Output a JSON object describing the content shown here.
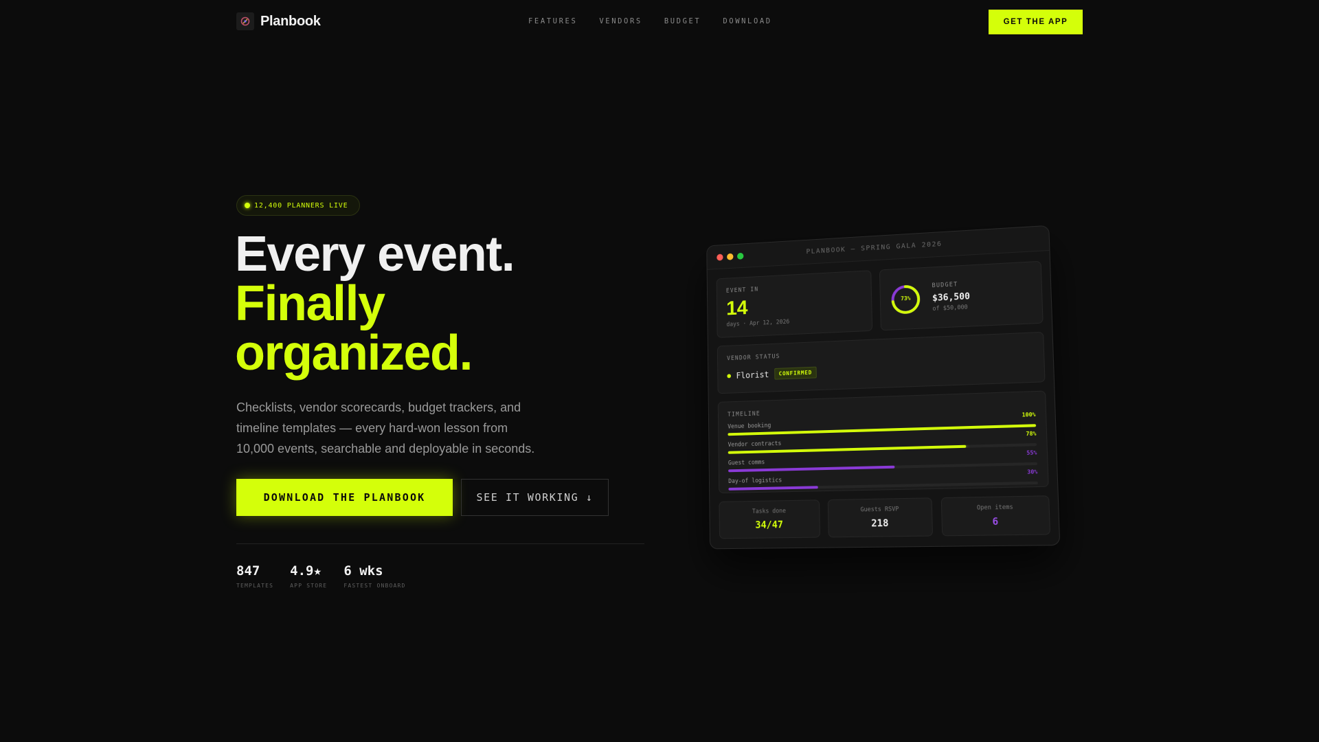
{
  "nav": {
    "brand": "Planbook",
    "links": [
      "FEATURES",
      "VENDORS",
      "BUDGET",
      "DOWNLOAD"
    ],
    "cta": "GET THE APP"
  },
  "hero": {
    "badge": "12,400 PLANNERS LIVE",
    "headline_1": "Every event.",
    "headline_2": "Finally",
    "headline_3": "organized.",
    "lede": "Checklists, vendor scorecards, budget trackers, and timeline templates — every hard-won lesson from 10,000 events, searchable and deployable in seconds.",
    "primary_cta": "DOWNLOAD THE PLANBOOK",
    "secondary_cta": "SEE IT WORKING ↓",
    "stats": [
      {
        "value": "847",
        "label": "TEMPLATES"
      },
      {
        "value": "4.9★",
        "label": "APP STORE"
      },
      {
        "value": "6 wks",
        "label": "FASTEST ONBOARD"
      }
    ]
  },
  "dashboard": {
    "window_title": "PLANBOOK — SPRING GALA 2026",
    "event": {
      "label": "EVENT IN",
      "days": "14",
      "sub": "days · Apr 12, 2026"
    },
    "budget": {
      "label": "BUDGET",
      "amount": "$36,500",
      "sub": "of $50,000",
      "percent_label": "73%",
      "percent": 73
    },
    "vendor": {
      "label": "VENDOR STATUS",
      "name": "Florist",
      "status": "CONFIRMED"
    },
    "timeline": {
      "label": "TIMELINE",
      "rows": [
        {
          "name": "Venue booking",
          "pct_label": "100%",
          "pct": 100,
          "color": "#d4ff0a"
        },
        {
          "name": "Vendor contracts",
          "pct_label": "78%",
          "pct": 78,
          "color": "#d4ff0a"
        },
        {
          "name": "Guest comms",
          "pct_label": "55%",
          "pct": 55,
          "color": "#8a3ad6"
        },
        {
          "name": "Day-of logistics",
          "pct_label": "30%",
          "pct": 30,
          "color": "#8a3ad6"
        }
      ]
    },
    "mini": [
      {
        "label": "Tasks done",
        "value": "34/47",
        "color": "#d4ff0a"
      },
      {
        "label": "Guests RSVP",
        "value": "218",
        "color": "#f0f0f0"
      },
      {
        "label": "Open items",
        "value": "6",
        "color": "#9b4ee8"
      }
    ]
  },
  "colors": {
    "accent": "#d4ff0a",
    "purple": "#8a3ad6",
    "background": "#0c0c0c"
  }
}
